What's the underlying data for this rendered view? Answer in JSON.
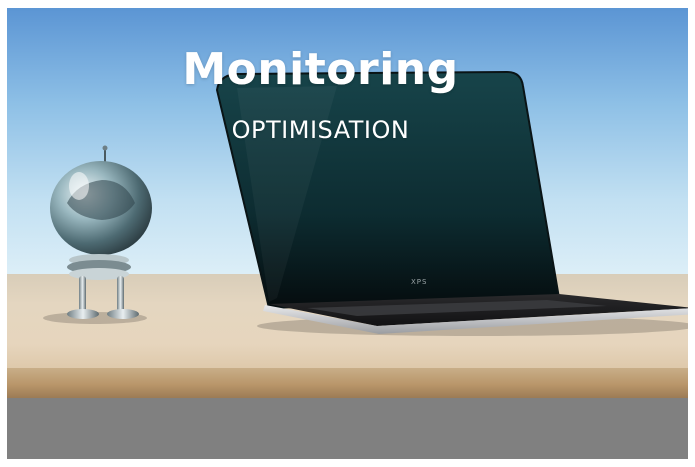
{
  "banner": {
    "title": "Monitoring",
    "subtitle": "OPTIMISATION"
  },
  "laptop": {
    "brand_label": "XPS"
  },
  "objects": {
    "robot_figure": "chrome-robot",
    "laptop": "laptop"
  },
  "colors": {
    "sky_top": "#5b95d4",
    "sky_bottom": "#dff0f8",
    "desk": "#e4d6c0",
    "floor": "#808080",
    "screen": "#0f3b40",
    "title": "#ffffff"
  }
}
